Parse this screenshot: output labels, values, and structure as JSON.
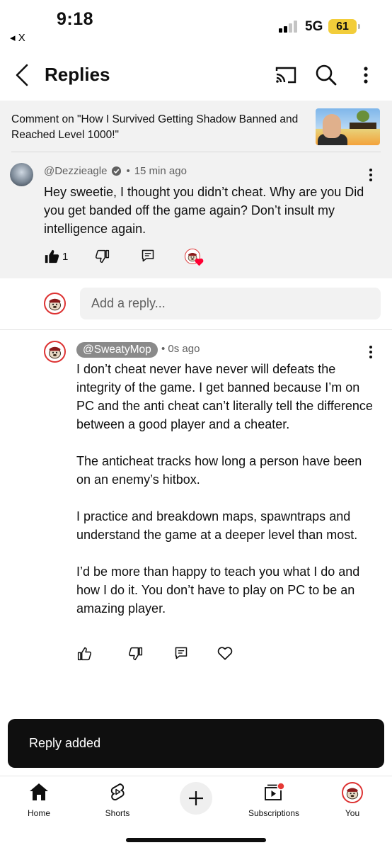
{
  "status_bar": {
    "time": "9:18",
    "back_app": "◂ X",
    "network": "5G",
    "battery": "61"
  },
  "header": {
    "title": "Replies",
    "icons": [
      "back-arrow-icon",
      "cast-icon",
      "search-icon",
      "more-vert-icon"
    ]
  },
  "context": {
    "text": "Comment on \"How I Survived Getting Shadow Banned and Reached Level 1000!\""
  },
  "parent_comment": {
    "author": "@Dezzieagle",
    "time": "15 min ago",
    "text": "Hey sweetie, I thought you didn’t cheat. Why are you Did you get banded off the game again? Don’t insult my intelligence again.",
    "likes": "1"
  },
  "reply_input": {
    "placeholder": "Add a reply..."
  },
  "reply_comment": {
    "author": "@SweatyMop",
    "time": "0s ago",
    "paragraphs": [
      "I don’t cheat never have never will defeats the integrity of the game. I get banned because I’m on PC and the anti cheat can’t literally tell the difference between a good player and a cheater.",
      "The anticheat tracks how long a person have been on an enemy’s hitbox.",
      "I practice and breakdown maps, spawntraps and understand the game at a deeper level than most.",
      "I’d be more than happy to teach you what I do and how I do it. You don’t have to play on PC to be an amazing player."
    ]
  },
  "toast": {
    "text": "Reply added"
  },
  "bottom_nav": {
    "home": "Home",
    "shorts": "Shorts",
    "subscriptions": "Subscriptions",
    "you": "You"
  },
  "colors": {
    "accent_red": "#ff0033",
    "grey_bg": "#f2f2f2",
    "battery_yellow": "#f2cd3a"
  }
}
